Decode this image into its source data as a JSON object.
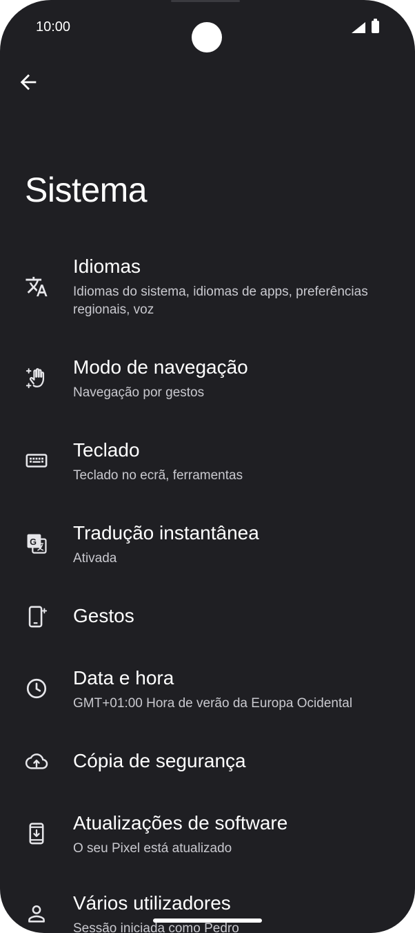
{
  "status_bar": {
    "time": "10:00"
  },
  "header": {
    "title": "Sistema"
  },
  "items": [
    {
      "title": "Idiomas",
      "subtitle": "Idiomas do sistema, idiomas de apps, preferências regionais, voz",
      "icon": "translate-icon"
    },
    {
      "title": "Modo de navegação",
      "subtitle": "Navegação por gestos",
      "icon": "gesture-hand-icon"
    },
    {
      "title": "Teclado",
      "subtitle": "Teclado no ecrã, ferramentas",
      "icon": "keyboard-icon"
    },
    {
      "title": "Tradução instantânea",
      "subtitle": "Ativada",
      "icon": "google-translate-icon"
    },
    {
      "title": "Gestos",
      "subtitle": "",
      "icon": "phone-gesture-icon"
    },
    {
      "title": "Data e hora",
      "subtitle": "GMT+01:00 Hora de verão da Europa Ocidental",
      "icon": "clock-icon"
    },
    {
      "title": "Cópia de segurança",
      "subtitle": "",
      "icon": "cloud-upload-icon"
    },
    {
      "title": "Atualizações de software",
      "subtitle": "O seu Pixel está atualizado",
      "icon": "system-update-icon"
    },
    {
      "title": "Vários utilizadores",
      "subtitle": "Sessão iniciada como Pedro",
      "icon": "person-icon"
    }
  ],
  "colors": {
    "background": "#1f1f23",
    "text": "#ffffff",
    "subtext": "#c9c9cf"
  }
}
